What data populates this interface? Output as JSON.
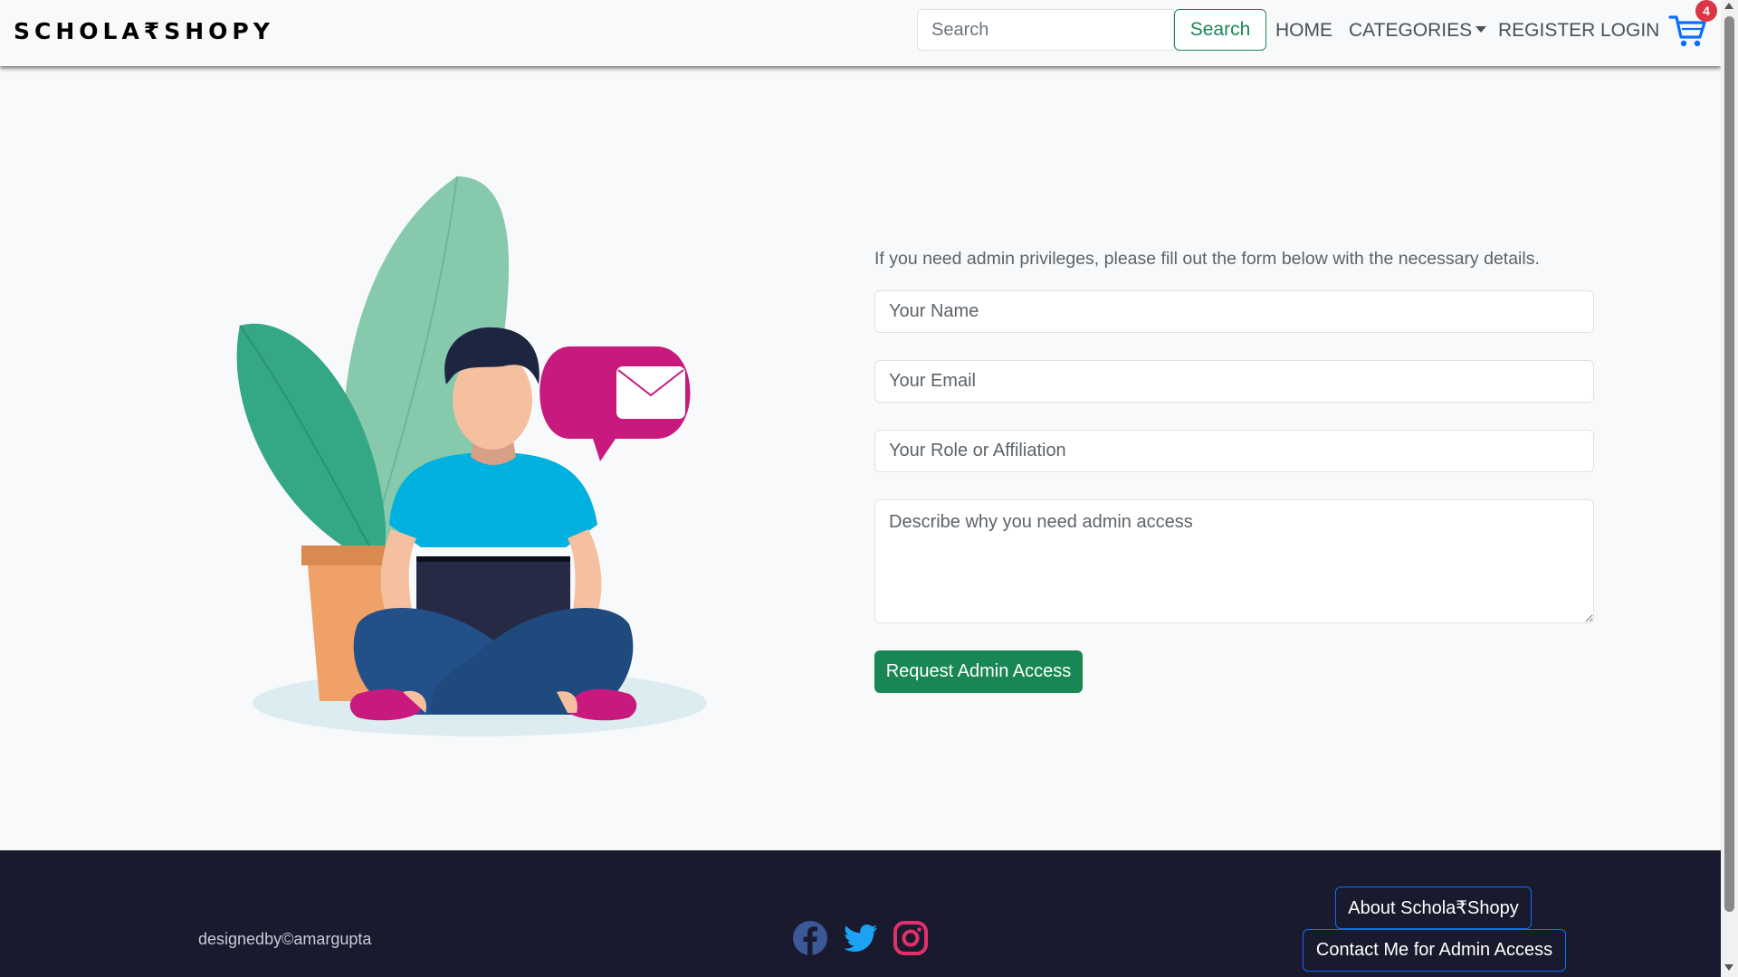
{
  "navbar": {
    "brand": "SCHOLA₹SHOPY",
    "search_placeholder": "Search",
    "search_button": "Search",
    "links": {
      "home": "HOME",
      "categories": "CATEGORIES",
      "register": "REGISTER",
      "login": "LOGIN"
    },
    "cart_count": "4"
  },
  "form": {
    "intro": "If you need admin privileges, please fill out the form below with the necessary details.",
    "name_placeholder": "Your Name",
    "email_placeholder": "Your Email",
    "role_placeholder": "Your Role or Affiliation",
    "reason_placeholder": "Describe why you need admin access",
    "submit_label": "Request Admin Access"
  },
  "footer": {
    "credit": "designedby©amargupta",
    "social": [
      "facebook-icon",
      "twitter-icon",
      "instagram-icon"
    ],
    "about_button": "About Schola₹Shopy",
    "contact_button": "Contact Me for Admin Access"
  },
  "colors": {
    "primary_green": "#198754",
    "footer_bg": "#1a1a2e",
    "cart_blue": "#0d6efd",
    "badge_red": "#dc3545",
    "bubble_magenta": "#c8197f"
  }
}
